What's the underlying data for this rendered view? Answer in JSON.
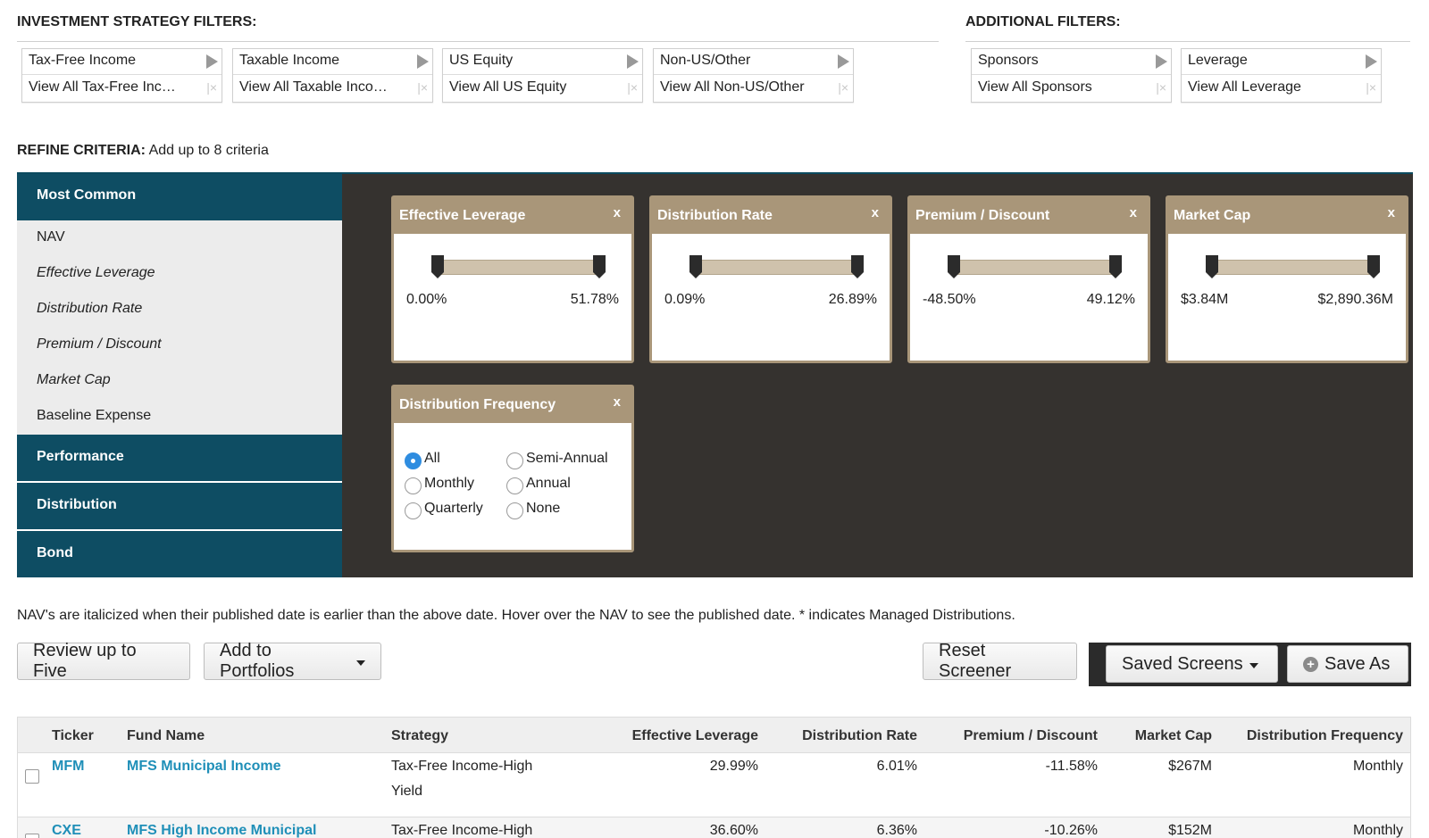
{
  "investment_filters": {
    "title": "INVESTMENT STRATEGY FILTERS:",
    "boxes": [
      {
        "label": "Tax-Free Income",
        "value": "View All Tax-Free Inc…"
      },
      {
        "label": "Taxable Income",
        "value": "View All Taxable Inco…"
      },
      {
        "label": "US Equity",
        "value": "View All US Equity"
      },
      {
        "label": "Non-US/Other",
        "value": "View All Non-US/Other"
      }
    ]
  },
  "additional_filters": {
    "title": "ADDITIONAL FILTERS:",
    "boxes": [
      {
        "label": "Sponsors",
        "value": "View All Sponsors"
      },
      {
        "label": "Leverage",
        "value": "View All Leverage"
      }
    ]
  },
  "clear_glyph": "|×",
  "refine": {
    "label_bold": "REFINE CRITERIA:",
    "label_rest": " Add up to 8 criteria"
  },
  "sidebar": {
    "most_common": "Most Common",
    "items": [
      "NAV",
      "Effective Leverage",
      "Distribution Rate",
      "Premium / Discount",
      "Market Cap",
      "Baseline Expense"
    ],
    "sections": [
      "Performance",
      "Distribution",
      "Bond"
    ]
  },
  "cards": [
    {
      "title": "Effective Leverage",
      "min": "0.00%",
      "max": "51.78%"
    },
    {
      "title": "Distribution Rate",
      "min": "0.09%",
      "max": "26.89%"
    },
    {
      "title": "Premium / Discount",
      "min": "-48.50%",
      "max": "49.12%"
    },
    {
      "title": "Market Cap",
      "min": "$3.84M",
      "max": "$2,890.36M"
    }
  ],
  "close_glyph": "x",
  "freq_card": {
    "title": "Distribution Frequency",
    "options": [
      "All",
      "Semi-Annual",
      "Monthly",
      "Annual",
      "Quarterly",
      "None"
    ],
    "selected": "All"
  },
  "note": "NAV's are italicized when their published date is earlier than the above date. Hover over the NAV to see the published date. * indicates Managed Distributions.",
  "buttons": {
    "review": "Review up to Five",
    "add_portfolios": "Add to Portfolios",
    "reset": "Reset Screener",
    "saved": "Saved Screens",
    "save_as": "Save As"
  },
  "table": {
    "headers": [
      "Ticker",
      "Fund Name",
      "Strategy",
      "Effective Leverage",
      "Distribution Rate",
      "Premium / Discount",
      "Market Cap",
      "Distribution Frequency"
    ],
    "rows": [
      {
        "ticker": "MFM",
        "name": "MFS Municipal Income",
        "strategy1": "Tax-Free Income-High",
        "strategy2": "Yield",
        "leverage": "29.99%",
        "rate": "6.01%",
        "premium": "-11.58%",
        "cap": "$267M",
        "freq": "Monthly"
      },
      {
        "ticker": "CXE",
        "name": "MFS High Income Municipal",
        "strategy1": "Tax-Free Income-High",
        "strategy2": "",
        "leverage": "36.60%",
        "rate": "6.36%",
        "premium": "-10.26%",
        "cap": "$152M",
        "freq": "Monthly"
      }
    ]
  }
}
